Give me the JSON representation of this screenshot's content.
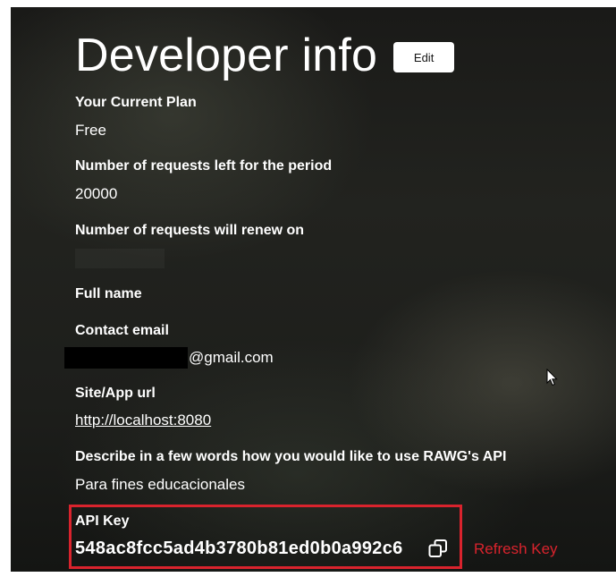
{
  "page": {
    "title": "Developer info",
    "edit_label": "Edit"
  },
  "fields": {
    "plan": {
      "label": "Your Current Plan",
      "value": "Free"
    },
    "requests_left": {
      "label": "Number of requests left for the period",
      "value": "20000"
    },
    "renew_on": {
      "label": "Number of requests will renew on",
      "value": ""
    },
    "full_name": {
      "label": "Full name",
      "value": ""
    },
    "contact_email": {
      "label": "Contact email",
      "value_suffix": "@gmail.com"
    },
    "site_url": {
      "label": "Site/App url",
      "value": "http://localhost:8080"
    },
    "usage": {
      "label": "Describe in a few words how you would like to use RAWG's API",
      "value": "Para fines educacionales"
    },
    "api_key": {
      "label": "API Key",
      "value": "548ac8fcc5ad4b3780b81ed0b0a992c6"
    }
  },
  "actions": {
    "refresh_key_label": "Refresh Key"
  },
  "icons": {
    "copy": "copy-icon",
    "cursor": "mouse-cursor-icon"
  },
  "colors": {
    "highlight_border": "#d9232d",
    "refresh_text": "#d9232d",
    "button_bg": "#ffffff"
  }
}
